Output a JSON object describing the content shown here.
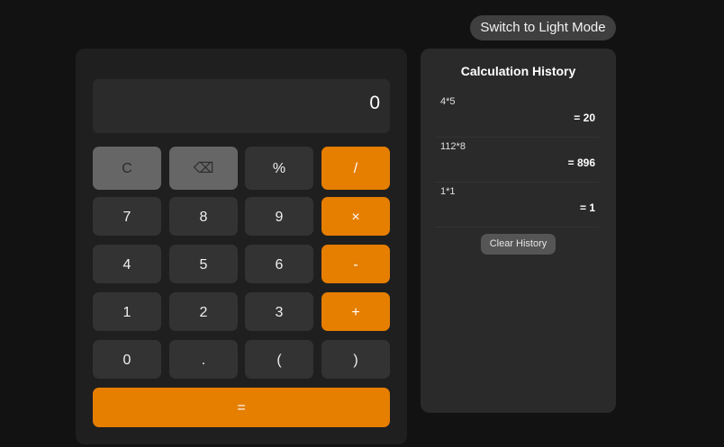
{
  "header": {
    "theme_toggle_label": "Switch to Light Mode"
  },
  "calculator": {
    "display_value": "0",
    "keys": {
      "clear": "C",
      "backspace": "⌫",
      "percent": "%",
      "divide": "/",
      "seven": "7",
      "eight": "8",
      "nine": "9",
      "multiply": "×",
      "four": "4",
      "five": "5",
      "six": "6",
      "subtract": "-",
      "one": "1",
      "two": "2",
      "three": "3",
      "add": "+",
      "zero": "0",
      "decimal": ".",
      "open_paren": "(",
      "close_paren": ")",
      "equals": "="
    },
    "colors": {
      "operator_accent": "#e67e00",
      "function_key": "#666666",
      "number_key": "#333333"
    }
  },
  "history": {
    "title": "Calculation History",
    "items": [
      {
        "expression": "4*5",
        "result": "= 20"
      },
      {
        "expression": "112*8",
        "result": "= 896"
      },
      {
        "expression": "1*1",
        "result": "= 1"
      }
    ],
    "clear_label": "Clear History"
  }
}
